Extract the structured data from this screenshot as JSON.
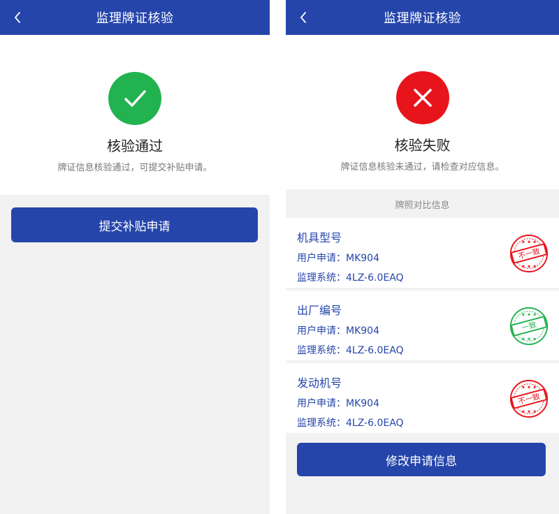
{
  "colors": {
    "primary": "#2545ab",
    "success": "#22b350",
    "fail": "#e8141b"
  },
  "left_screen": {
    "nav_title": "监理牌证核验",
    "back_icon": "chevron-left-icon",
    "status_icon": "check-icon",
    "status_title": "核验通过",
    "status_desc": "牌证信息核验通过，可提交补贴申请。",
    "submit_label": "提交补贴申请"
  },
  "right_screen": {
    "nav_title": "监理牌证核验",
    "back_icon": "chevron-left-icon",
    "status_icon": "cross-icon",
    "status_title": "核验失败",
    "status_desc": "牌证信息核验未通过，请检查对应信息。",
    "section_title": "牌照对比信息",
    "items": [
      {
        "title": "机具型号",
        "user_label": "用户申请：",
        "user_value": "MK904",
        "system_label": "监理系统：",
        "system_value": "4LZ-6.0EAQ",
        "seal_text": "不一致",
        "seal_type": "mismatch"
      },
      {
        "title": "出厂编号",
        "user_label": "用户申请：",
        "user_value": "MK904",
        "system_label": "监理系统：",
        "system_value": "4LZ-6.0EAQ",
        "seal_text": "一致",
        "seal_type": "match"
      },
      {
        "title": "发动机号",
        "user_label": "用户申请：",
        "user_value": "MK904",
        "system_label": "监理系统：",
        "system_value": "4LZ-6.0EAQ",
        "seal_text": "不一致",
        "seal_type": "mismatch"
      }
    ],
    "modify_label": "修改申请信息"
  }
}
